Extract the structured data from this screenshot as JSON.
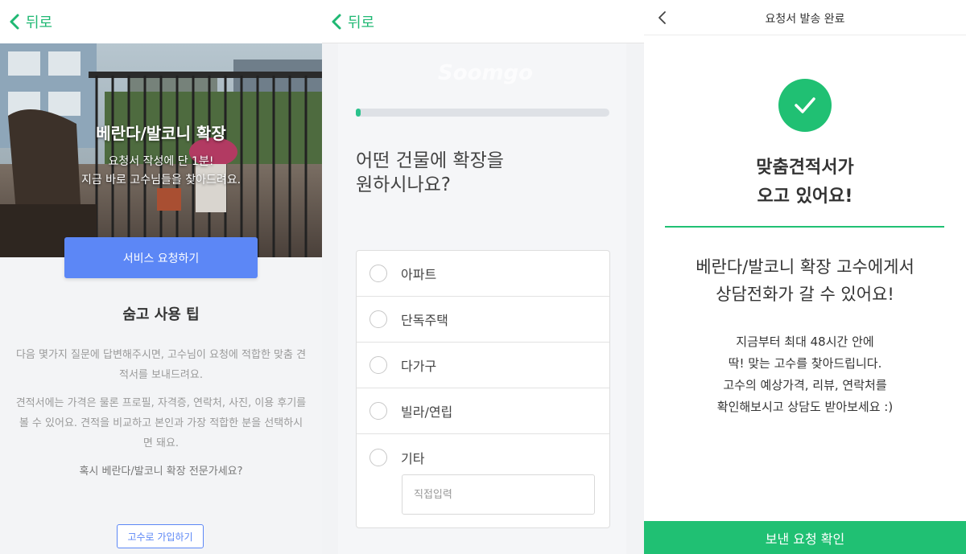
{
  "panel1": {
    "back_label": "뒤로",
    "hero": {
      "title": "베란다/발코니 확장",
      "subtitle_line1": "요청서 작성에 단 1분!",
      "subtitle_line2": "지금 바로 고수님들을 찾아드려요."
    },
    "service_button": "서비스 요청하기",
    "tips_title": "숨고 사용 팁",
    "tip1": "다음 몇가지 질문에 답변해주시면, 고수님이 요청에 적합한 맞춤 견적서를 보내드려요.",
    "tip2": "견적서에는 가격은 물론 프로필, 자격증, 연락처, 사진, 이용 후기를 볼 수 있어요. 견적을 비교하고 본인과 가장 적합한 분을 선택하시면 돼요.",
    "tip3": "혹시 베란다/발코니 확장 전문가세요?",
    "join_button": "고수로 가입하기"
  },
  "panel2": {
    "back_label": "뒤로",
    "progress": 0.02,
    "question_line1": "어떤 건물에 확장을",
    "question_line2": "원하시나요?",
    "options": [
      {
        "label": "아파트"
      },
      {
        "label": "단독주택"
      },
      {
        "label": "다가구"
      },
      {
        "label": "빌라/연립"
      },
      {
        "label": "기타"
      }
    ],
    "direct_input_placeholder": "직접입력"
  },
  "panel3": {
    "header_title": "요청서 발송 완료",
    "headline_line1": "맞춤견적서가",
    "headline_line2": "오고 있어요!",
    "message_line1": "베란다/발코니 확장 고수에게서",
    "message_line2": "상담전화가 갈 수 있어요!",
    "info_line1": "지금부터 최대 48시간 안에",
    "info_line2": "딱! 맞는 고수를 찾아드립니다.",
    "info_line3": "고수의 예상가격, 리뷰, 연락처를",
    "info_line4": "확인해보시고 상담도 받아보세요 :)",
    "confirm_button": "보낸 요청 확인"
  },
  "colors": {
    "brand_green": "#20c073",
    "primary_blue": "#5c87f6"
  }
}
